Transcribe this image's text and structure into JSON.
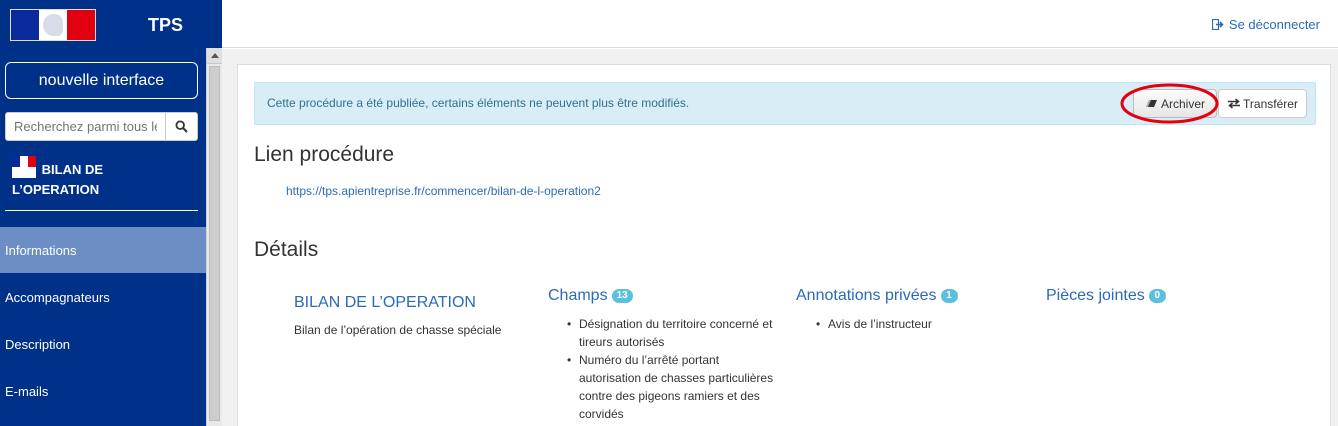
{
  "sidebar": {
    "brand_title": "TPS",
    "new_interface_label": "nouvelle interface",
    "search_placeholder": "Recherchez parmi tous les dossiers",
    "procedure_name_line1": "BILAN DE",
    "procedure_name_line2": "L’OPERATION",
    "nav": [
      {
        "label": "Informations",
        "active": true
      },
      {
        "label": "Accompagnateurs",
        "active": false
      },
      {
        "label": "Description",
        "active": false
      },
      {
        "label": "E-mails",
        "active": false
      }
    ]
  },
  "header": {
    "logout_label": "Se déconnecter"
  },
  "alert": {
    "text": "Cette procédure a été publiée, certains éléments ne peuvent plus être modifiés.",
    "archive_label": "Archiver",
    "transfer_label": "Transférer",
    "highlight_color": "#e4000f"
  },
  "lien": {
    "heading": "Lien procédure",
    "url": "https://tps.apientreprise.fr/commencer/bilan-de-l-operation2"
  },
  "details": {
    "heading": "Détails",
    "title": "BILAN DE L’OPERATION",
    "description": "Bilan de l’opération de chasse spéciale",
    "champs": {
      "label": "Champs",
      "count": "13",
      "items": [
        "Désignation du territoire concerné et tireurs autorisés",
        "Numéro du l’arrêté portant autorisation de chasses particulières contre des pigeons ramiers et des corvidés"
      ]
    },
    "annotations": {
      "label": "Annotations privées",
      "count": "1",
      "items": [
        "Avis de l’instructeur"
      ]
    },
    "pieces": {
      "label": "Pièces jointes",
      "count": "0"
    }
  },
  "colors": {
    "sidebar_bg": "#003189",
    "nav_active_bg": "#6c8ec5",
    "link": "#2a6bb8",
    "alert_bg": "#d9edf7",
    "badge": "#5bc0de"
  }
}
